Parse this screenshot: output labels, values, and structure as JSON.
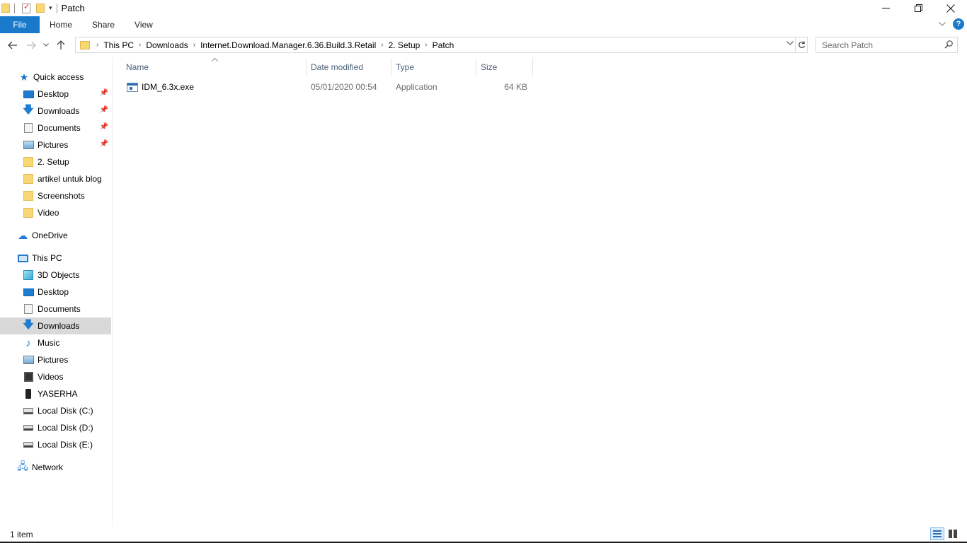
{
  "window": {
    "title": "Patch",
    "controls": {
      "minimize_icon": "minimize-icon",
      "restore_icon": "restore-icon",
      "close_icon": "close-icon"
    }
  },
  "ribbon": {
    "tabs": [
      "File",
      "Home",
      "Share",
      "View"
    ],
    "help_label": "?"
  },
  "address": {
    "breadcrumbs": [
      "This PC",
      "Downloads",
      "Internet.Download.Manager.6.36.Build.3.Retail",
      "2. Setup",
      "Patch"
    ]
  },
  "search": {
    "placeholder": "Search Patch"
  },
  "nav_pane": {
    "quick_access": {
      "label": "Quick access",
      "items": [
        {
          "label": "Desktop",
          "icon": "desktop-icon",
          "pinned": true
        },
        {
          "label": "Downloads",
          "icon": "downloads-icon",
          "pinned": true
        },
        {
          "label": "Documents",
          "icon": "documents-icon",
          "pinned": true
        },
        {
          "label": "Pictures",
          "icon": "pictures-icon",
          "pinned": true
        },
        {
          "label": "2. Setup",
          "icon": "folder-icon",
          "pinned": false
        },
        {
          "label": "artikel untuk blog",
          "icon": "folder-icon",
          "pinned": false
        },
        {
          "label": "Screenshots",
          "icon": "folder-icon",
          "pinned": false
        },
        {
          "label": "Video",
          "icon": "folder-icon",
          "pinned": false
        }
      ]
    },
    "onedrive": {
      "label": "OneDrive"
    },
    "this_pc": {
      "label": "This PC",
      "items": [
        {
          "label": "3D Objects",
          "icon": "3d-objects-icon"
        },
        {
          "label": "Desktop",
          "icon": "desktop-icon"
        },
        {
          "label": "Documents",
          "icon": "documents-icon"
        },
        {
          "label": "Downloads",
          "icon": "downloads-icon",
          "selected": true
        },
        {
          "label": "Music",
          "icon": "music-icon"
        },
        {
          "label": "Pictures",
          "icon": "pictures-icon"
        },
        {
          "label": "Videos",
          "icon": "videos-icon"
        },
        {
          "label": "YASERHA",
          "icon": "phone-icon"
        },
        {
          "label": "Local Disk (C:)",
          "icon": "system-disk-icon"
        },
        {
          "label": "Local Disk (D:)",
          "icon": "disk-icon"
        },
        {
          "label": "Local Disk (E:)",
          "icon": "disk-icon"
        }
      ]
    },
    "network": {
      "label": "Network"
    }
  },
  "file_list": {
    "columns": [
      "Name",
      "Date modified",
      "Type",
      "Size"
    ],
    "sorted_by": "Name",
    "rows": [
      {
        "name": "IDM_6.3x.exe",
        "date_modified": "05/01/2020 00:54",
        "type": "Application",
        "size": "64 KB",
        "icon": "exe-icon"
      }
    ]
  },
  "status_bar": {
    "item_count": "1 item",
    "views": [
      "details-view",
      "large-icons-view"
    ],
    "active_view": "details-view"
  },
  "colors": {
    "accent": "#1979ca",
    "selection": "#d9d9d9",
    "header_text": "#4c607a",
    "muted_text": "#6d6d6d",
    "folder": "#f8d775"
  }
}
